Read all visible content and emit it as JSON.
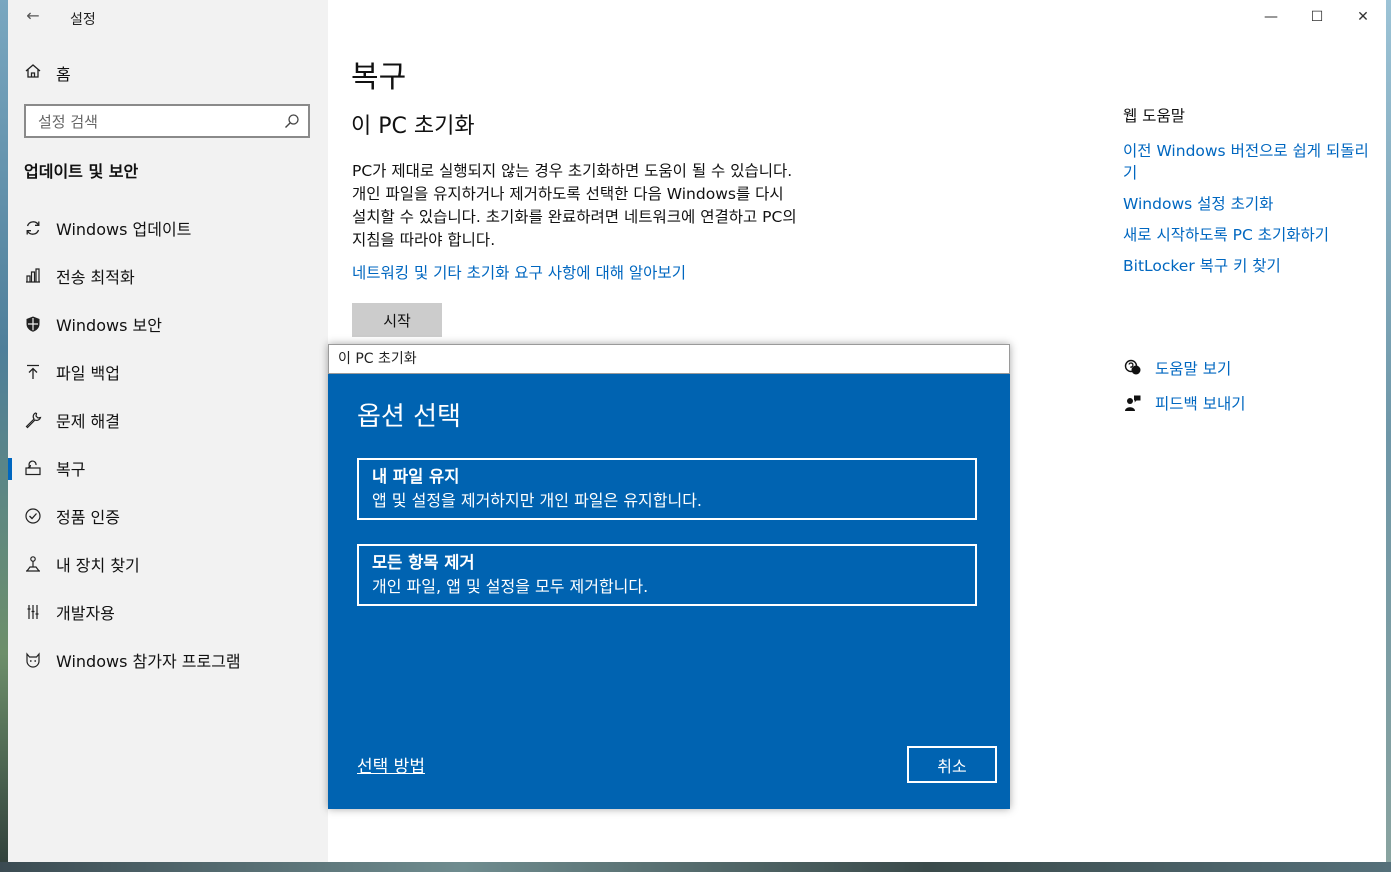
{
  "window": {
    "app_title": "설정",
    "back_glyph": "←",
    "controls": {
      "minimize": "—",
      "maximize": "☐",
      "close": "✕"
    }
  },
  "sidebar": {
    "home_label": "홈",
    "search": {
      "placeholder": "설정 검색"
    },
    "section_title": "업데이트 및 보안",
    "items": [
      {
        "label": "Windows 업데이트",
        "icon": "sync-icon"
      },
      {
        "label": "전송 최적화",
        "icon": "delivery-optimization-icon"
      },
      {
        "label": "Windows 보안",
        "icon": "shield-icon"
      },
      {
        "label": "파일 백업",
        "icon": "backup-icon"
      },
      {
        "label": "문제 해결",
        "icon": "wrench-icon"
      },
      {
        "label": "복구",
        "icon": "recovery-icon",
        "active": true
      },
      {
        "label": "정품 인증",
        "icon": "activation-check-icon"
      },
      {
        "label": "내 장치 찾기",
        "icon": "find-device-icon"
      },
      {
        "label": "개발자용",
        "icon": "developer-icon"
      },
      {
        "label": "Windows 참가자 프로그램",
        "icon": "insider-cat-icon"
      }
    ]
  },
  "main": {
    "page_title": "복구",
    "reset_title": "이 PC 초기화",
    "reset_description": "PC가 제대로 실행되지 않는 경우 초기화하면 도움이 될 수 있습니다. 개인 파일을 유지하거나 제거하도록 선택한 다음 Windows를 다시 설치할 수 있습니다. 초기화를 완료하려면 네트워크에 연결하고 PC의 지침을 따라야 합니다.",
    "learn_more_link": "네트워킹 및 기타 초기화 요구 사항에 대해 알아보기",
    "start_button": "시작"
  },
  "help_panel": {
    "heading": "웹 도움말",
    "links": [
      "이전 Windows 버전으로 쉽게 되돌리기",
      "Windows 설정 초기화",
      "새로 시작하도록 PC 초기화하기",
      "BitLocker 복구 키 찾기"
    ],
    "get_help": "도움말 보기",
    "give_feedback": "피드백 보내기"
  },
  "dialog": {
    "title": "이 PC 초기화",
    "heading": "옵션 선택",
    "options": [
      {
        "title": "내 파일 유지",
        "description": "앱 및 설정을 제거하지만 개인 파일은 유지합니다."
      },
      {
        "title": "모든 항목 제거",
        "description": "개인 파일, 앱 및 설정을 모두 제거합니다."
      }
    ],
    "help_link": "선택 방법",
    "cancel_button": "취소"
  },
  "colors": {
    "accent": "#0067c0",
    "dialog_background": "#0063b1",
    "sidebar_background": "#f2f2f2"
  }
}
